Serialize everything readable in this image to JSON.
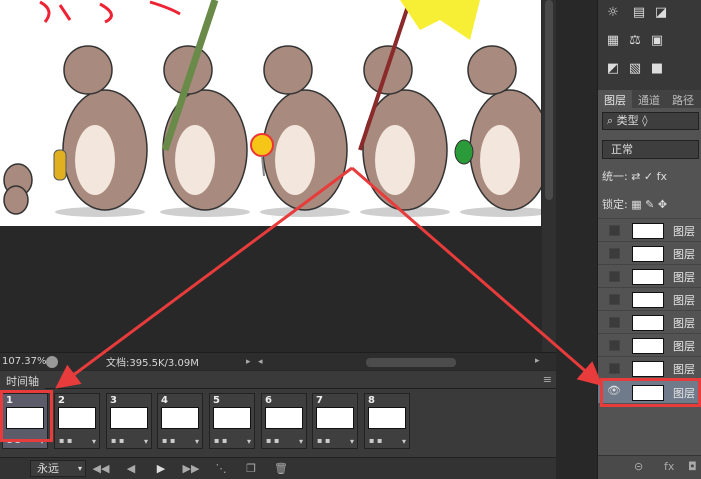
{
  "status": {
    "zoom": "107.37%",
    "doc_info": "文档:395.5K/3.09M"
  },
  "timeline": {
    "tab_label": "时间轴",
    "frames": [
      {
        "num": "1"
      },
      {
        "num": "2"
      },
      {
        "num": "3"
      },
      {
        "num": "4"
      },
      {
        "num": "5"
      },
      {
        "num": "6"
      },
      {
        "num": "7"
      },
      {
        "num": "8"
      }
    ],
    "loop_label": "永远"
  },
  "layers_panel": {
    "tabs": [
      "图层",
      "通道",
      "路径"
    ],
    "filter_label": "类型",
    "blend_mode": "正常",
    "unify_label": "统一:",
    "lock_label": "锁定:",
    "layers": [
      {
        "name": "图层"
      },
      {
        "name": "图层"
      },
      {
        "name": "图层"
      },
      {
        "name": "图层"
      },
      {
        "name": "图层"
      },
      {
        "name": "图层"
      },
      {
        "name": "图层"
      },
      {
        "name": "图层"
      }
    ]
  },
  "colors": {
    "highlight": "#e83b3b",
    "selected_layer": "#6f7a8a"
  }
}
